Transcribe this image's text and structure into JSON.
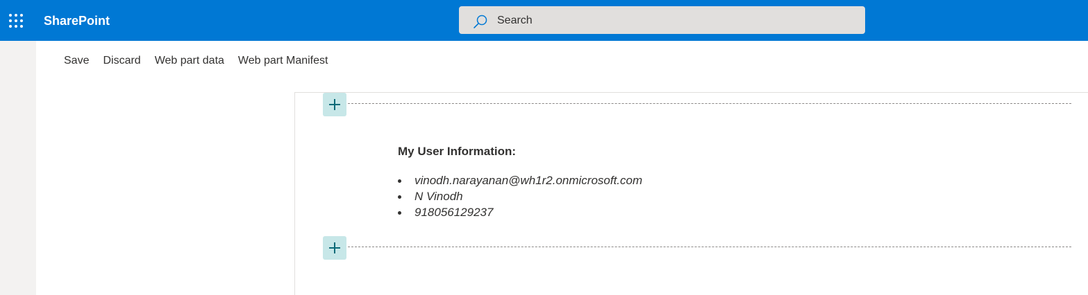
{
  "colors": {
    "brand": "#0078d4",
    "rail": "#f3f2f1",
    "add_button": "#c7e7e8"
  },
  "topbar": {
    "app_launcher_icon": "waffle-icon",
    "app_title": "SharePoint",
    "search": {
      "placeholder": "Search",
      "icon": "search-icon"
    }
  },
  "commandbar": {
    "items": [
      "Save",
      "Discard",
      "Web part data",
      "Web part Manifest"
    ]
  },
  "canvas": {
    "add_section_icon": "plus-icon",
    "webpart": {
      "heading": "My User Information:",
      "items": [
        "vinodh.narayanan@wh1r2.onmicrosoft.com",
        "N Vinodh",
        "918056129237"
      ]
    }
  }
}
